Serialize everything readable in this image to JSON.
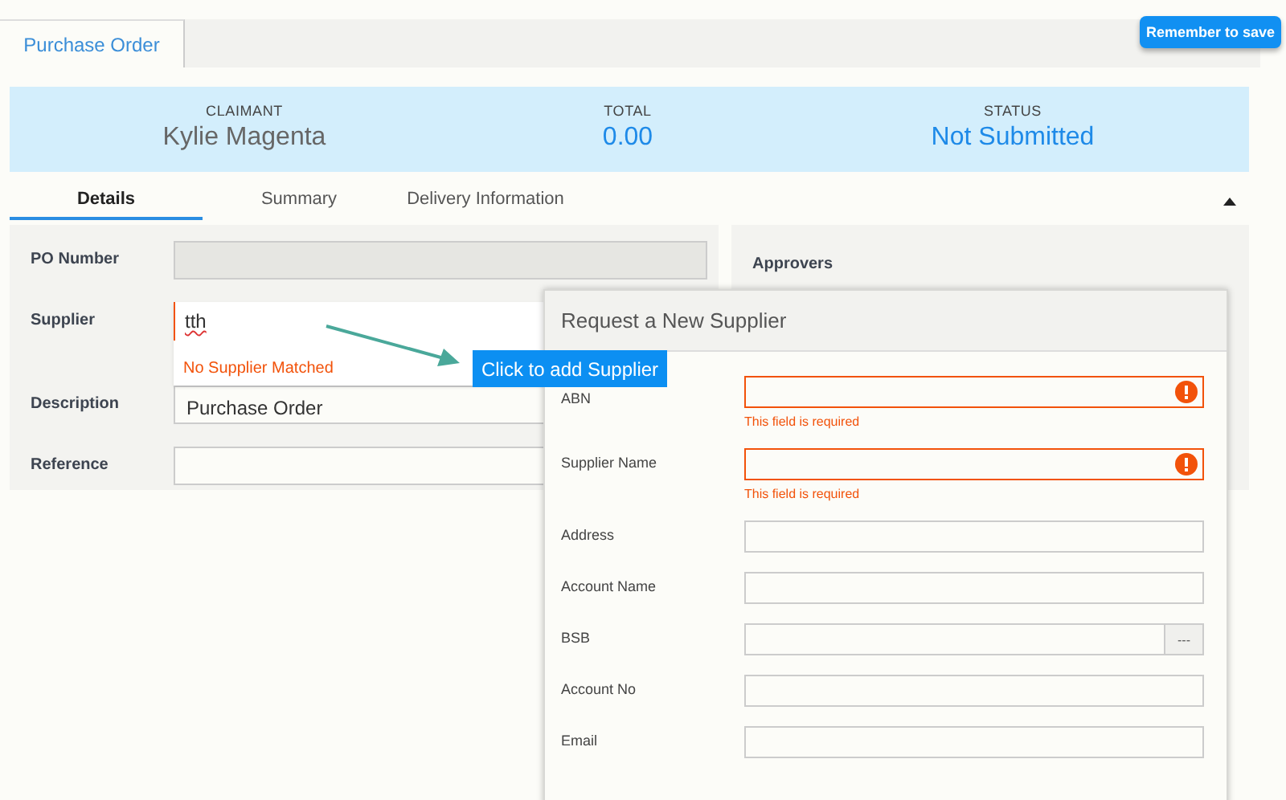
{
  "page_tabs": [
    {
      "label": "Purchase Order",
      "selected": true
    }
  ],
  "save_button": "Remember to save",
  "summary": [
    {
      "label": "CLAIMANT",
      "value": "Kylie Magenta",
      "kind": "name"
    },
    {
      "label": "TOTAL",
      "value": "0.00",
      "kind": "highlight"
    },
    {
      "label": "STATUS",
      "value": "Not Submitted",
      "kind": "highlight"
    }
  ],
  "section_tabs": [
    {
      "label": "Details",
      "selected": true
    },
    {
      "label": "Summary",
      "selected": false
    },
    {
      "label": "Delivery Information",
      "selected": false
    }
  ],
  "collapsed": false,
  "form": [
    {
      "label": "PO Number",
      "disabled": true
    },
    {
      "label": "Supplier",
      "value": "tth",
      "disabled": false,
      "kind": "lookup"
    },
    {
      "label": "Description",
      "value": "Purchase Order",
      "disabled": false
    },
    {
      "label": "Reference",
      "disabled": false
    }
  ],
  "supplier_dropdown": {
    "message": "No Supplier Matched"
  },
  "tooltip": "Click to add Supplier",
  "approvers": {
    "title": "Approvers"
  },
  "modal": {
    "title": "Request a New Supplier",
    "fields": [
      {
        "label": "ABN",
        "invalid": true,
        "error": "This field is required"
      },
      {
        "label": "Supplier Name",
        "invalid": true,
        "error": "This field is required"
      },
      {
        "label": "Address",
        "invalid": false
      },
      {
        "label": "Account Name",
        "invalid": false
      },
      {
        "label": "BSB",
        "invalid": false,
        "button": "---"
      },
      {
        "label": "Account No",
        "invalid": false
      },
      {
        "label": "Email",
        "invalid": false
      }
    ]
  }
}
